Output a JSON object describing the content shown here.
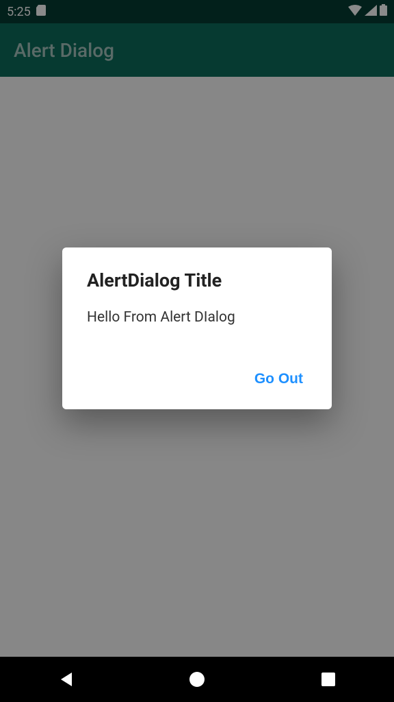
{
  "status_bar": {
    "time": "5:25"
  },
  "app_bar": {
    "title": "Alert Dialog"
  },
  "dialog": {
    "title": "AlertDialog Title",
    "message": "Hello From Alert DIalog",
    "action_label": "Go Out"
  }
}
